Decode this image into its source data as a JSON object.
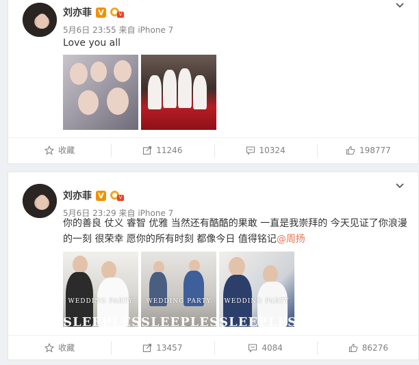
{
  "posts": [
    {
      "author": "刘亦菲",
      "verified_badge": "V",
      "medal_icon": "medal-icon",
      "timestamp": "5月6日 23:55",
      "source": "来自 iPhone 7",
      "text": "Love you all",
      "mention": "",
      "images": [
        {
          "icon": "group-selfie-photo"
        },
        {
          "icon": "bridesmaids-photo"
        }
      ],
      "actions": {
        "favorite": "收藏",
        "repost": "11246",
        "comment": "10324",
        "like": "198777"
      }
    },
    {
      "author": "刘亦菲",
      "verified_badge": "V",
      "medal_icon": "medal-icon",
      "timestamp": "5月6日 23:29",
      "source": "来自 iPhone 7",
      "text": "你的善良 仗义 睿智 优雅 当然还有酷酷的果敢 一直是我崇拜的 今天见证了你浪漫的一刻 很荣幸 愿你的所有时刻 都像今日 值得铭记",
      "mention": "@周扬",
      "images": [
        {
          "caption": "WEDDING PARTY",
          "title": "SLEEPLESS"
        },
        {
          "caption": "WEDDING PARTY",
          "title": "SLEEPLESS"
        },
        {
          "caption": "WEDDING PARTY",
          "title": "SLEEPLESS"
        }
      ],
      "actions": {
        "favorite": "收藏",
        "repost": "13457",
        "comment": "4084",
        "like": "86276"
      }
    }
  ],
  "colors": {
    "accent_orange": "#eb7350",
    "verified": "#f29100",
    "meta_gray": "#808080"
  }
}
